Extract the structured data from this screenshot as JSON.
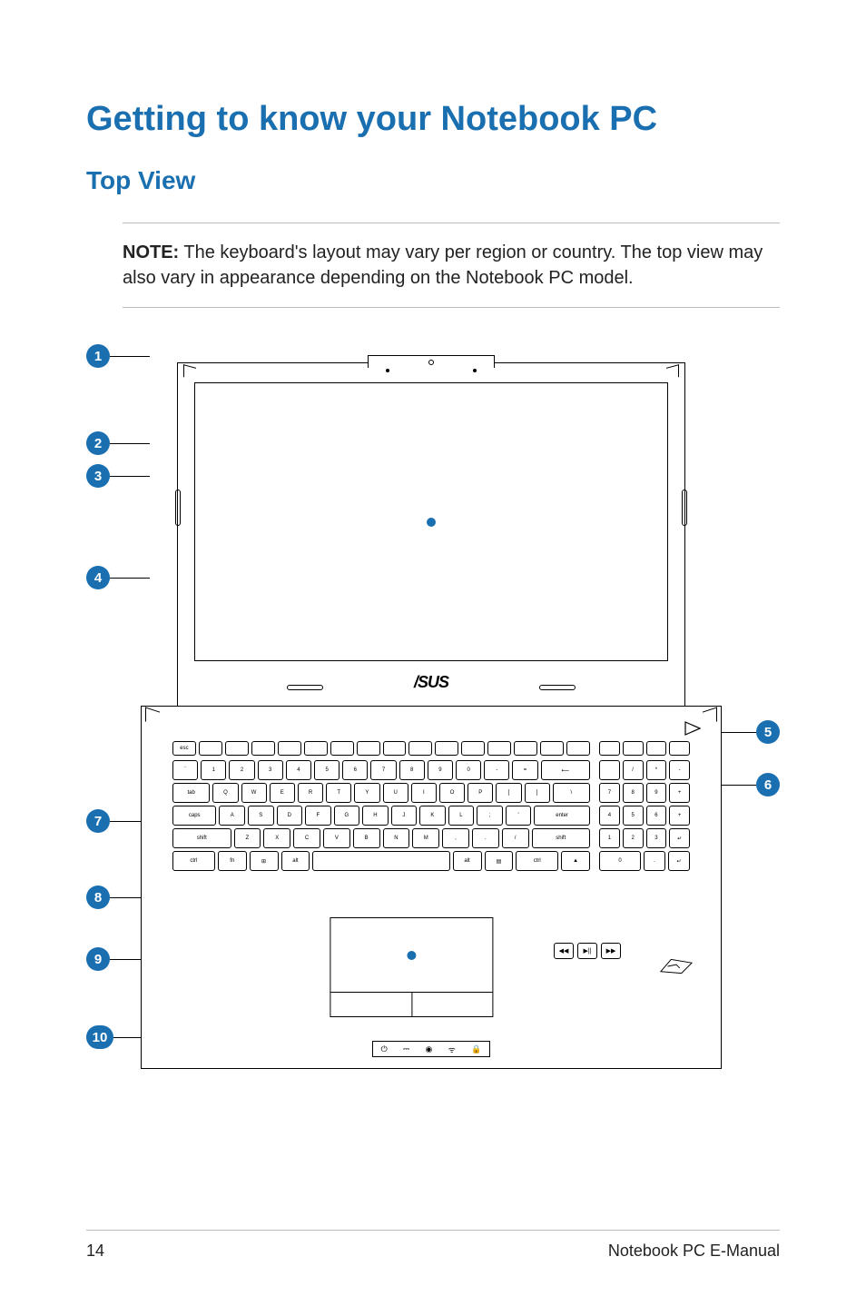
{
  "headings": {
    "title": "Getting to know your Notebook PC",
    "subtitle": "Top View"
  },
  "note": {
    "label": "NOTE:",
    "text": " The keyboard's layout may vary per region or country. The top view may also vary in appearance depending on the Notebook PC model."
  },
  "callouts": [
    "1",
    "2",
    "3",
    "4",
    "5",
    "6",
    "7",
    "8",
    "9",
    "10"
  ],
  "logo": "/SUS",
  "indicators": [
    "⏻",
    "⎓",
    "◉",
    "ᯤ",
    "🔒"
  ],
  "media_keys": [
    "◀◀",
    "▶||",
    "▶▶"
  ],
  "footer": {
    "page": "14",
    "doc": "Notebook PC E-Manual"
  }
}
